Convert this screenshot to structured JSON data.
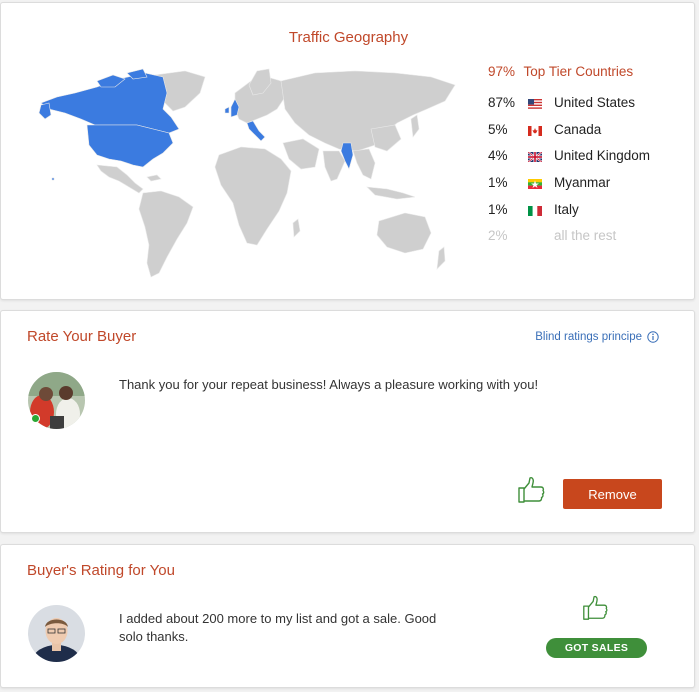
{
  "geography": {
    "title": "Traffic Geography",
    "top_tier": {
      "percent": "97%",
      "label": "Top Tier Countries"
    },
    "countries": [
      {
        "percent": "87%",
        "name": "United States",
        "flag": "us-flag-icon"
      },
      {
        "percent": "5%",
        "name": "Canada",
        "flag": "canada-flag-icon"
      },
      {
        "percent": "4%",
        "name": "United Kingdom",
        "flag": "uk-flag-icon"
      },
      {
        "percent": "1%",
        "name": "Myanmar",
        "flag": "myanmar-flag-icon"
      },
      {
        "percent": "1%",
        "name": "Italy",
        "flag": "italy-flag-icon"
      }
    ],
    "rest": {
      "percent": "2%",
      "label": "all the rest"
    },
    "colors": {
      "highlight": "#3b7be0",
      "land": "#cfcfcf",
      "accent": "#c0482a"
    }
  },
  "rate_buyer": {
    "title": "Rate Your Buyer",
    "blind_link": "Blind ratings principe",
    "comment": "Thank you for your repeat business! Always a pleasure working with you!",
    "remove_label": "Remove",
    "colors": {
      "remove": "#c8471d",
      "thumb": "#3f8f3a"
    }
  },
  "buyer_rating": {
    "title": "Buyer's Rating for You",
    "comment_line1": "I added about 200 more to my list and got a sale. Good",
    "comment_line2": "solo thanks.",
    "badge": "GOT SALES",
    "colors": {
      "badge": "#3f8f3a"
    }
  }
}
